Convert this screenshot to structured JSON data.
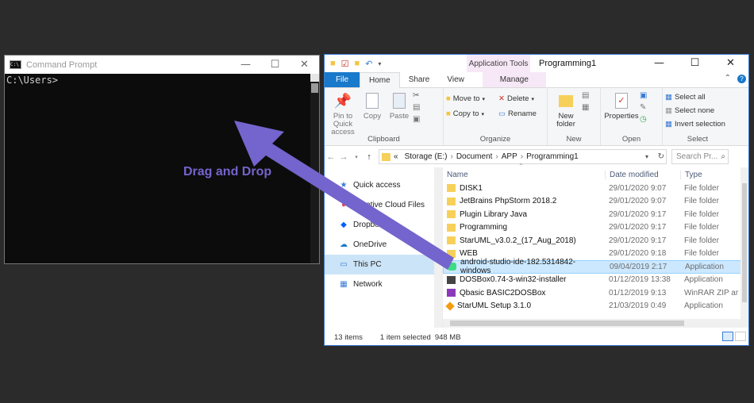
{
  "cmd": {
    "title": "Command Prompt",
    "icon_text": "C:\\",
    "prompt": "C:\\Users>",
    "minimize": "—",
    "maximize": "☐",
    "close": "✕"
  },
  "explorer": {
    "title": "Programming1",
    "app_tools": "Application Tools",
    "tabs": [
      "File",
      "Home",
      "Share",
      "View",
      "Manage"
    ],
    "ribbon": {
      "clipboard": {
        "label": "Clipboard",
        "pin": "Pin to Quick access",
        "copy": "Copy",
        "paste": "Paste"
      },
      "organize": {
        "label": "Organize",
        "move_to": "Move to",
        "copy_to": "Copy to",
        "delete": "Delete",
        "rename": "Rename"
      },
      "new": {
        "label": "New",
        "new_folder": "New folder"
      },
      "open": {
        "label": "Open",
        "properties": "Properties"
      },
      "select": {
        "label": "Select",
        "select_all": "Select all",
        "select_none": "Select none",
        "invert": "Invert selection"
      }
    },
    "address": {
      "prefix": "«",
      "crumbs": [
        "Storage (E:)",
        "Document",
        "APP",
        "Programming1"
      ],
      "search_placeholder": "Search Pr..."
    },
    "nav": [
      {
        "label": "Quick access",
        "icon": "star-icon"
      },
      {
        "label": "Creative Cloud Files",
        "icon": "creative-cloud-icon"
      },
      {
        "label": "Dropbox",
        "icon": "dropbox-icon"
      },
      {
        "label": "OneDrive",
        "icon": "onedrive-icon"
      },
      {
        "label": "This PC",
        "icon": "computer-icon"
      },
      {
        "label": "Network",
        "icon": "network-icon"
      }
    ],
    "columns": {
      "name": "Name",
      "date": "Date modified",
      "type": "Type"
    },
    "files": [
      {
        "name": "DISK1",
        "date": "29/01/2020 9:07",
        "type": "File folder",
        "icon": "folder-icon"
      },
      {
        "name": "JetBrains PhpStorm 2018.2",
        "date": "29/01/2020 9:07",
        "type": "File folder",
        "icon": "folder-icon"
      },
      {
        "name": "Plugin Library Java",
        "date": "29/01/2020 9:17",
        "type": "File folder",
        "icon": "folder-icon"
      },
      {
        "name": "Programming",
        "date": "29/01/2020 9:17",
        "type": "File folder",
        "icon": "folder-icon"
      },
      {
        "name": "StarUML_v3.0.2_(17_Aug_2018)",
        "date": "29/01/2020 9:17",
        "type": "File folder",
        "icon": "folder-icon"
      },
      {
        "name": "WEB",
        "date": "29/01/2020 9:18",
        "type": "File folder",
        "icon": "folder-icon"
      },
      {
        "name": "android-studio-ide-182.5314842-windows",
        "date": "09/04/2019 2:17",
        "type": "Application",
        "icon": "android-studio-icon",
        "selected": true
      },
      {
        "name": "DOSBox0.74-3-win32-installer",
        "date": "01/12/2019 13:38",
        "type": "Application",
        "icon": "dosbox-icon"
      },
      {
        "name": "Qbasic BASIC2DOSBox",
        "date": "01/12/2019 9:13",
        "type": "WinRAR ZIP ar",
        "icon": "winrar-icon"
      },
      {
        "name": "StarUML Setup 3.1.0",
        "date": "21/03/2019 0:49",
        "type": "Application",
        "icon": "staruml-icon"
      }
    ],
    "status": {
      "items": "13 items",
      "selected": "1 item selected",
      "size": "948 MB"
    }
  },
  "annotation": {
    "text": "Drag and Drop",
    "color": "#7464cd"
  }
}
